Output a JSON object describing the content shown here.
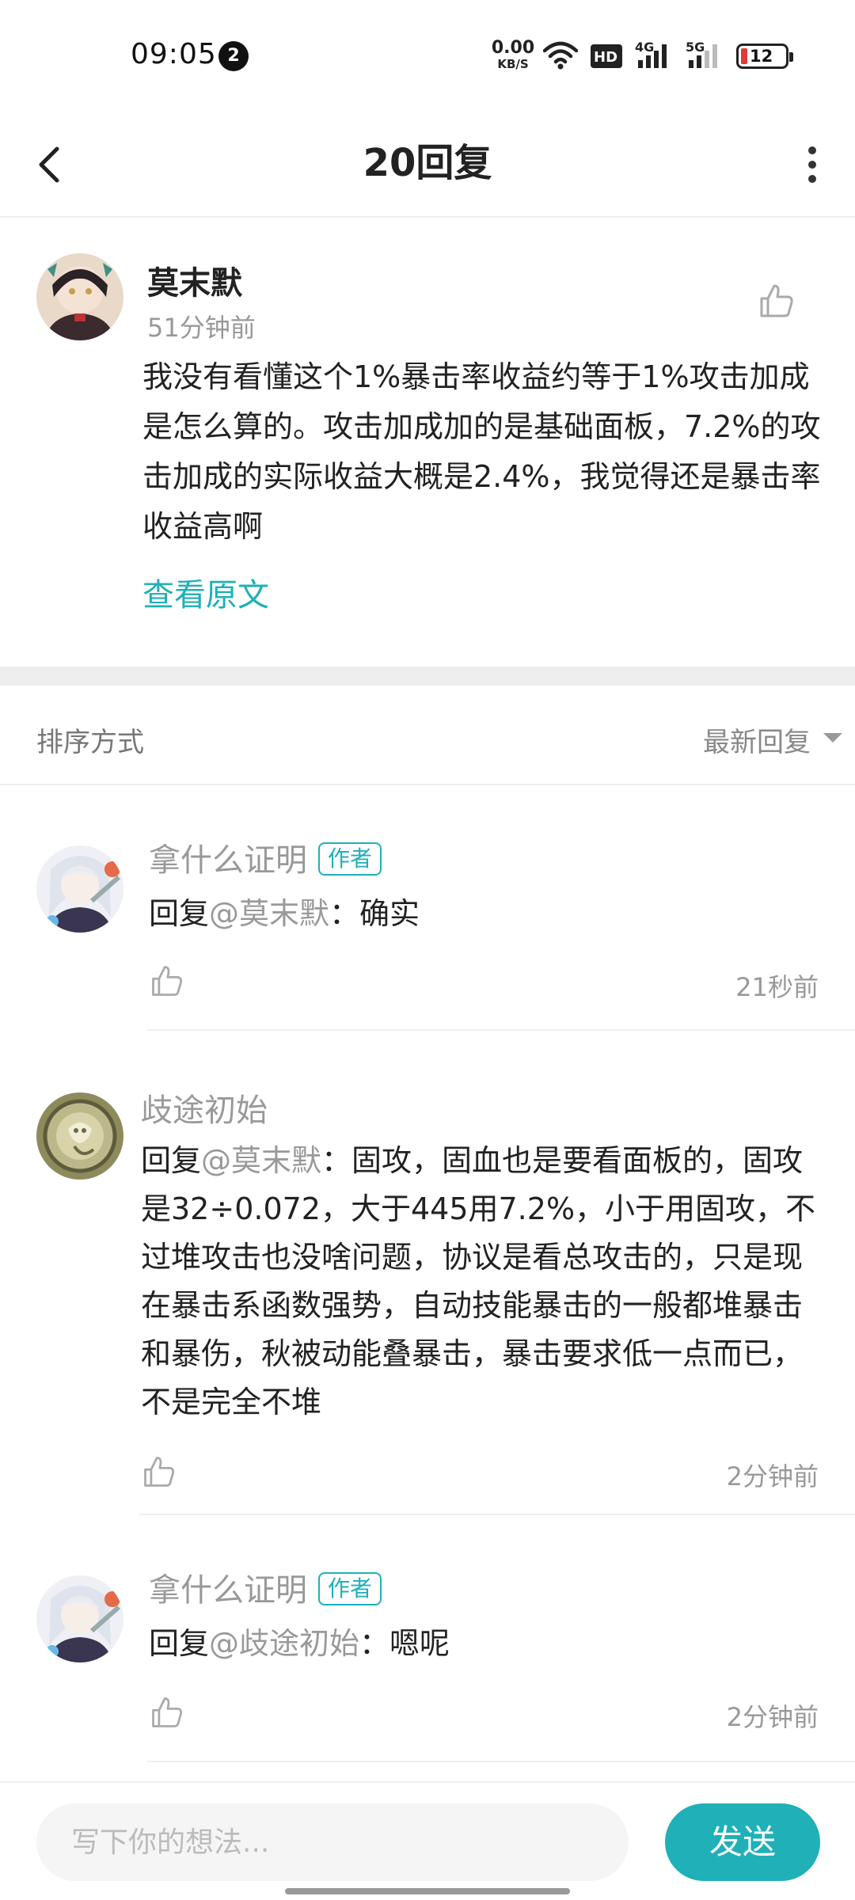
{
  "status_bar": {
    "time": "09:05",
    "notification_count": "2",
    "net_speed_value": "0.00",
    "net_speed_unit": "KB/S",
    "hd_label": "HD",
    "signal_1_label": "4G",
    "signal_2_label": "5G",
    "battery_level": "12",
    "battery_color": "#e53935"
  },
  "header": {
    "title": "20回复",
    "back_icon": "chevron-left-icon",
    "more_icon": "more-vertical-icon"
  },
  "post": {
    "author": "莫末默",
    "time": "51分钟前",
    "content": "我没有看懂这个1%暴击率收益约等于1%攻击加成是怎么算的。攻击加成加的是基础面板，7.2%的攻击加成的实际收益大概是2.4%，我觉得还是暴击率收益高啊",
    "view_original": "查看原文"
  },
  "sort": {
    "label": "排序方式",
    "value": "最新回复"
  },
  "replies": [
    {
      "author": "拿什么证明",
      "badge": "作者",
      "reply_prefix": "回复",
      "mention": "@莫末默",
      "text": "：确实",
      "time": "21秒前"
    },
    {
      "author": "歧途初始",
      "badge": "",
      "reply_prefix": "回复",
      "mention": "@莫末默",
      "text": "：固攻，固血也是要看面板的，固攻是32÷0.072，大于445用7.2%，小于用固攻，不过堆攻击也没啥问题，协议是看总攻击的，只是现在暴击系函数强势，自动技能暴击的一般都堆暴击和暴伤，秋被动能叠暴击，暴击要求低一点而已，不是完全不堆",
      "time": "2分钟前"
    },
    {
      "author": "拿什么证明",
      "badge": "作者",
      "reply_prefix": "回复",
      "mention": "@歧途初始",
      "text": "：嗯呢",
      "time": "2分钟前"
    }
  ],
  "composer": {
    "placeholder": "写下你的想法...",
    "send_label": "发送"
  },
  "colors": {
    "accent": "#1fb0b8",
    "muted_text": "#999999"
  }
}
